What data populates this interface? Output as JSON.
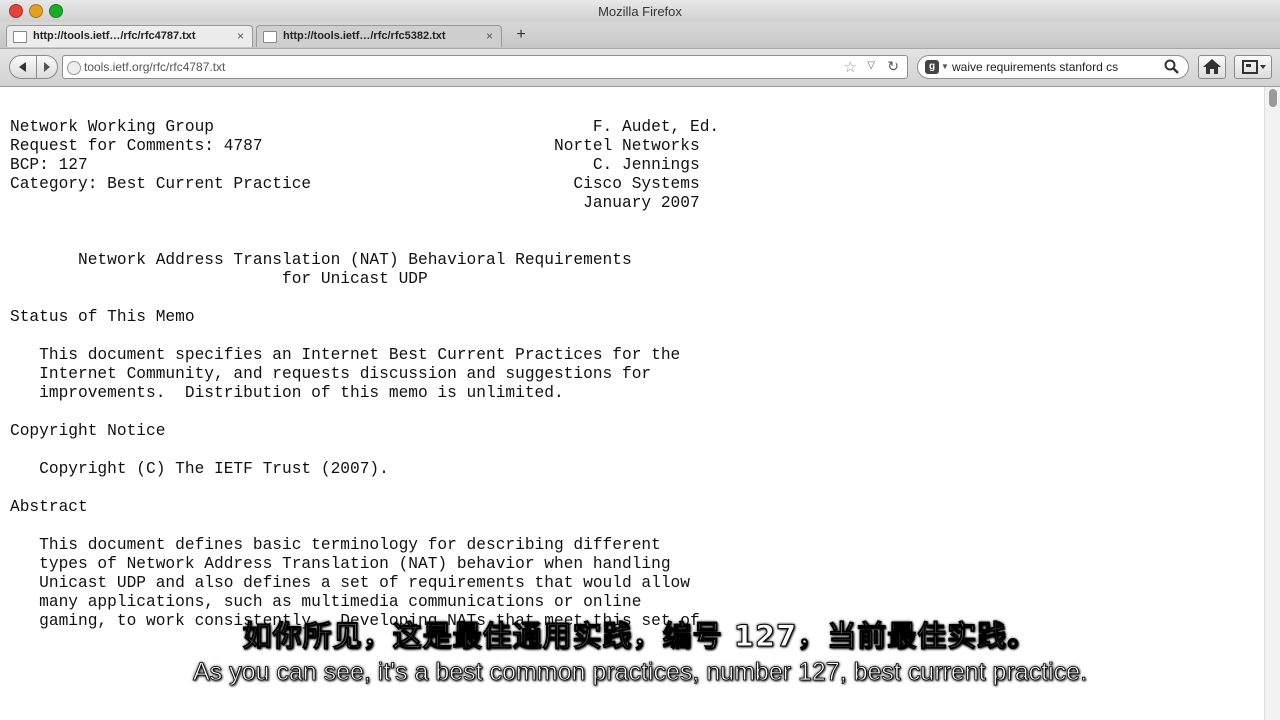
{
  "window": {
    "title": "Mozilla Firefox"
  },
  "tabs": [
    {
      "label": "http://tools.ietf…/rfc/rfc4787.txt",
      "close": "×"
    },
    {
      "label": "http://tools.ietf…/rfc/rfc5382.txt",
      "close": "×"
    }
  ],
  "newtab_label": "+",
  "navbar": {
    "url": "tools.ietf.org/rfc/rfc4787.txt",
    "search_value": "waive requirements stanford cs"
  },
  "document": {
    "lines": [
      "Network Working Group                                       F. Audet, Ed.",
      "Request for Comments: 4787                              Nortel Networks",
      "BCP: 127                                                    C. Jennings",
      "Category: Best Current Practice                           Cisco Systems",
      "                                                           January 2007",
      "",
      "",
      "       Network Address Translation (NAT) Behavioral Requirements",
      "                            for Unicast UDP",
      "",
      "Status of This Memo",
      "",
      "   This document specifies an Internet Best Current Practices for the",
      "   Internet Community, and requests discussion and suggestions for",
      "   improvements.  Distribution of this memo is unlimited.",
      "",
      "Copyright Notice",
      "",
      "   Copyright (C) The IETF Trust (2007).",
      "",
      "Abstract",
      "",
      "   This document defines basic terminology for describing different",
      "   types of Network Address Translation (NAT) behavior when handling",
      "   Unicast UDP and also defines a set of requirements that would allow",
      "   many applications, such as multimedia communications or online",
      "   gaming, to work consistently.  Developing NATs that meet this set of"
    ]
  },
  "subtitles": {
    "chinese": "如你所见，这是最佳通用实践，编号 127，当前最佳实践。",
    "english": "As you can see, it's a best common practices, number 127, best current practice."
  }
}
